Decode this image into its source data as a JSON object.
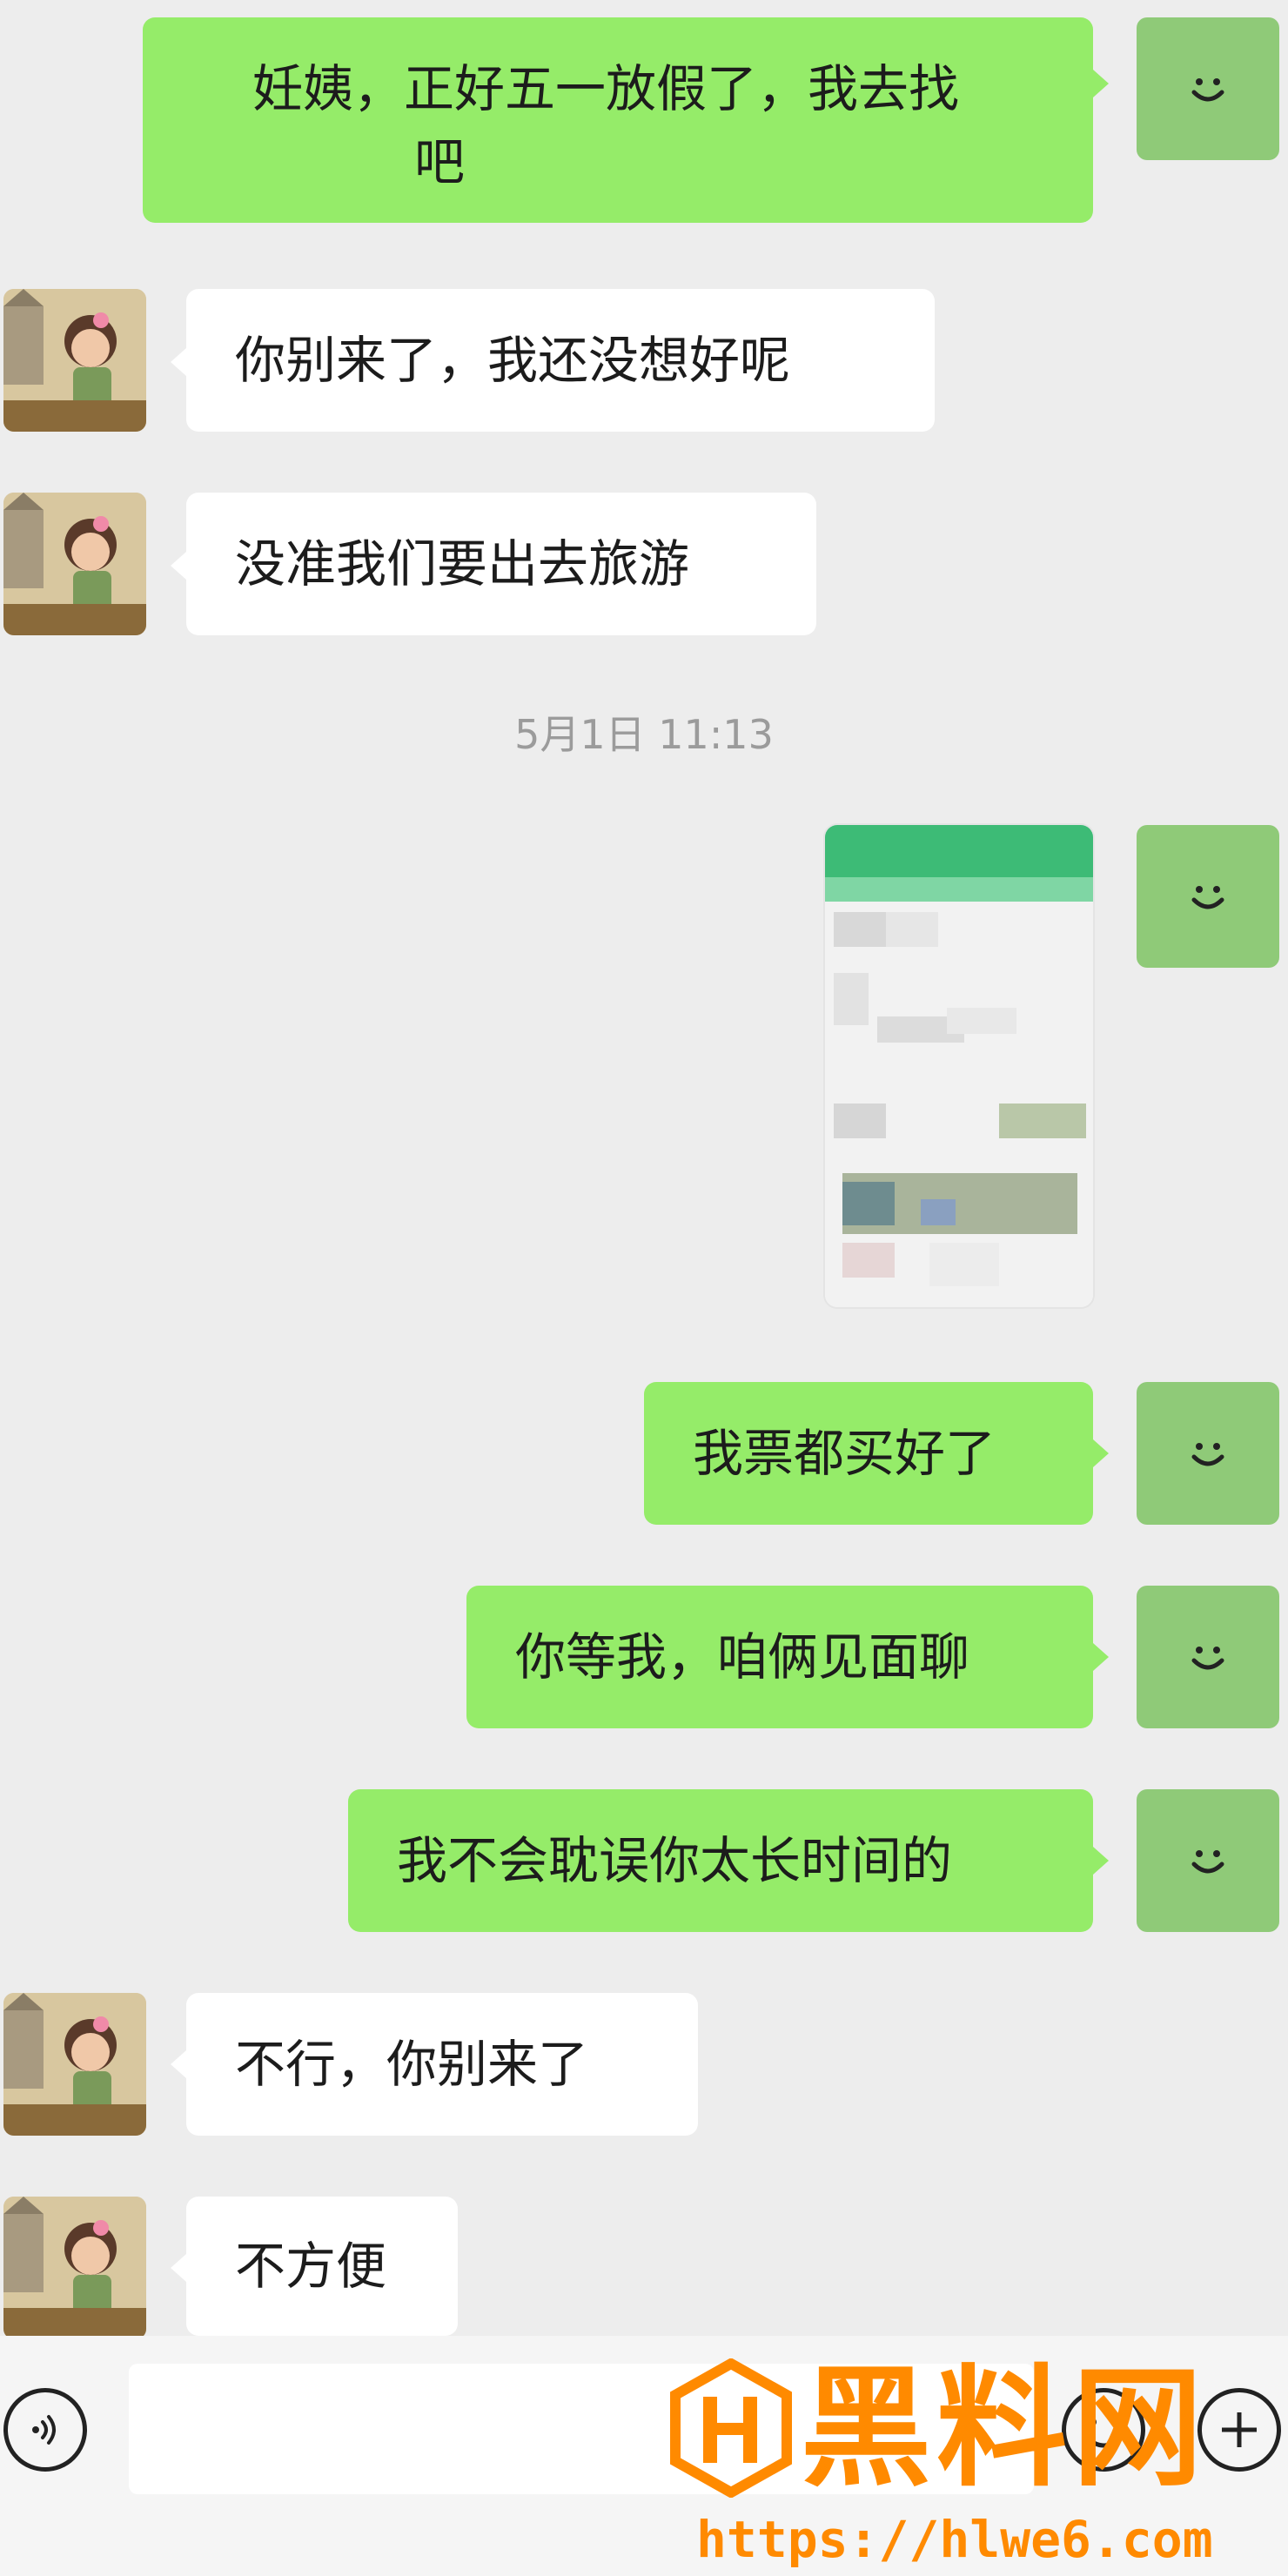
{
  "conversation": {
    "messages_before": [
      {
        "from": "me",
        "text": "妊姨，正好五一放假了，我去找",
        "text2": "吧"
      },
      {
        "from": "them",
        "text": "你别来了，我还没想好呢"
      },
      {
        "from": "them",
        "text": "没准我们要出去旅游"
      }
    ],
    "timestamp": "5月1日 11:13",
    "messages_after": [
      {
        "from": "me",
        "text": "我票都买好了"
      },
      {
        "from": "me",
        "text": "你等我，咱俩见面聊"
      },
      {
        "from": "me",
        "text": "我不会耽误你太长时间的"
      },
      {
        "from": "them",
        "text": "不行，你别来了"
      },
      {
        "from": "them",
        "text": "不方便"
      }
    ]
  },
  "icons": {
    "my_avatar": "smiley-icon",
    "their_avatar": "cartoon-girl-avatar",
    "voice": "voice-icon",
    "emoji": "emoji-icon",
    "more": "plus-icon"
  },
  "watermark": {
    "name": "黑料网",
    "url": "https://hlwe6.com"
  },
  "colors": {
    "my_bubble": "#95ec69",
    "their_bubble": "#ffffff",
    "background": "#ededed",
    "watermark": "#ff8a00"
  }
}
